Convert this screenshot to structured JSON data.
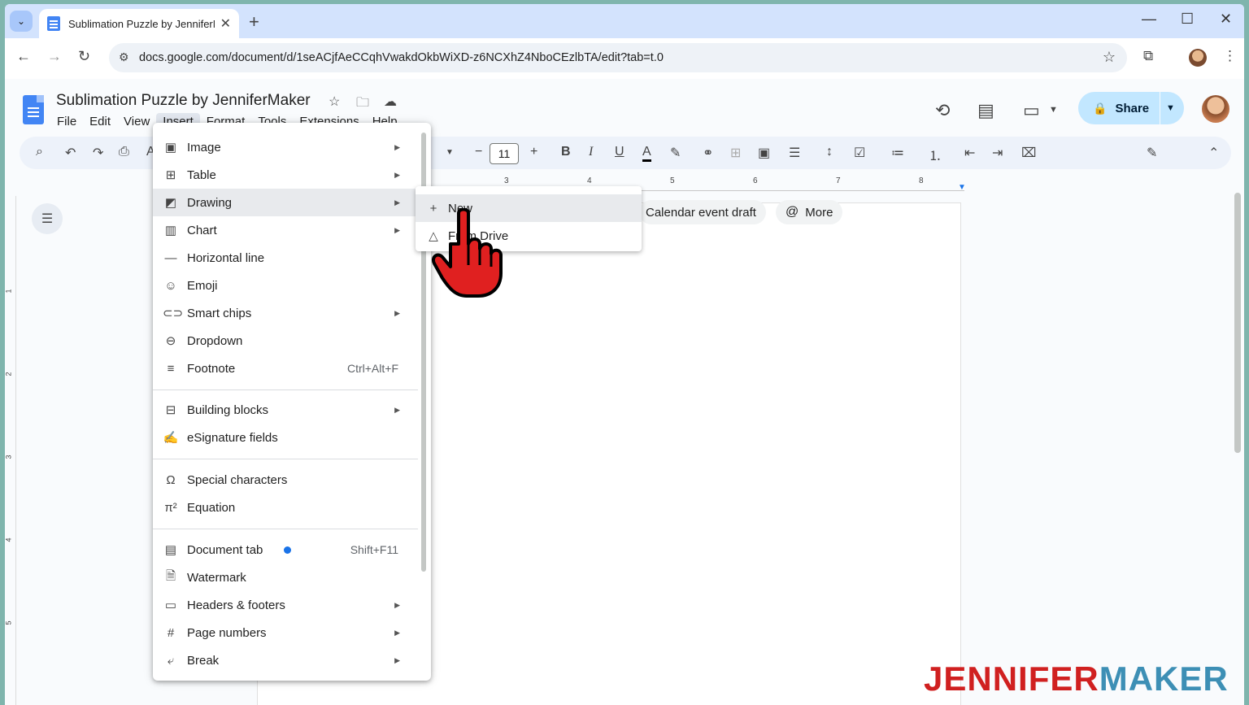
{
  "browser": {
    "tab_title": "Sublimation Puzzle by JenniferMaker",
    "url": "docs.google.com/document/d/1seACjfAeCCqhVwakdOkbWiXD-z6NCXhZ4NboCEzlbTA/edit?tab=t.0"
  },
  "doc": {
    "title": "Sublimation Puzzle by JenniferMaker",
    "menus": [
      "File",
      "Edit",
      "View",
      "Insert",
      "Format",
      "Tools",
      "Extensions",
      "Help"
    ],
    "active_menu": "Insert",
    "share_label": "Share",
    "font_size": "11"
  },
  "ruler": {
    "numbers": [
      "3",
      "4",
      "5",
      "6",
      "7",
      "8"
    ]
  },
  "vruler": {
    "numbers": [
      "1",
      "2",
      "3",
      "4",
      "5"
    ]
  },
  "chips": {
    "calendar": "Calendar event draft",
    "more": "More"
  },
  "insert_menu": {
    "items": [
      {
        "label": "Image",
        "icon": "image-icon",
        "arrow": true
      },
      {
        "label": "Table",
        "icon": "table-icon",
        "arrow": true
      },
      {
        "label": "Drawing",
        "icon": "drawing-icon",
        "arrow": true
      },
      {
        "label": "Chart",
        "icon": "chart-icon",
        "arrow": true
      },
      {
        "label": "Horizontal line",
        "icon": "horizontal-line-icon"
      },
      {
        "label": "Emoji",
        "icon": "emoji-icon"
      },
      {
        "label": "Smart chips",
        "icon": "smart-chips-icon",
        "arrow": true
      },
      {
        "label": "Dropdown",
        "icon": "dropdown-icon"
      },
      {
        "label": "Footnote",
        "icon": "footnote-icon",
        "shortcut": "Ctrl+Alt+F"
      },
      {
        "label": "Building blocks",
        "icon": "building-blocks-icon",
        "arrow": true
      },
      {
        "label": "eSignature fields",
        "icon": "esignature-icon"
      },
      {
        "label": "Special characters",
        "icon": "omega-icon"
      },
      {
        "label": "Equation",
        "icon": "pi-icon"
      },
      {
        "label": "Document tab",
        "icon": "document-tab-icon",
        "shortcut": "Shift+F11"
      },
      {
        "label": "Watermark",
        "icon": "watermark-icon"
      },
      {
        "label": "Headers & footers",
        "icon": "headers-footers-icon",
        "arrow": true
      },
      {
        "label": "Page numbers",
        "icon": "hash-icon",
        "arrow": true
      },
      {
        "label": "Break",
        "icon": "break-icon",
        "arrow": true
      }
    ]
  },
  "drawing_submenu": {
    "new": "New",
    "from_drive": "From Drive"
  },
  "watermark": {
    "part1": "JENNIFER",
    "part2": "MAKER"
  },
  "colors": {
    "accent": "#1a73e8",
    "brand_red": "#d02020",
    "brand_blue": "#3d8fb5",
    "share_bg": "#c2e7ff"
  }
}
